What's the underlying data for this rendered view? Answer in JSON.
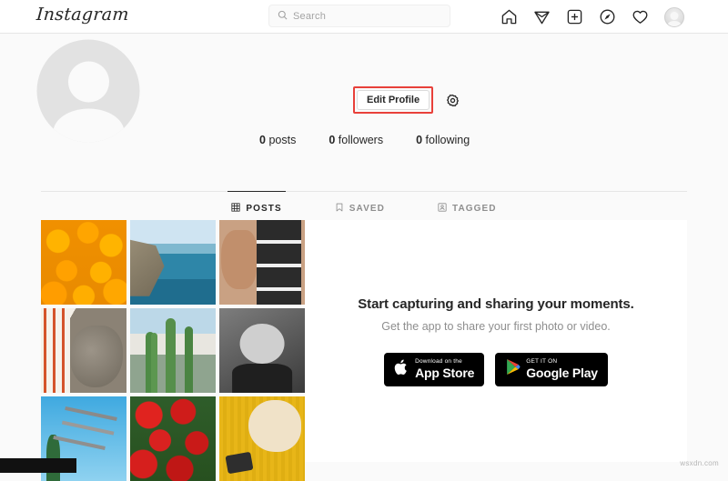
{
  "nav": {
    "logo": "Instagram",
    "search": {
      "placeholder": "Search",
      "value": ""
    },
    "icons": [
      {
        "name": "home-icon",
        "label": "Home"
      },
      {
        "name": "direct-send-icon",
        "label": "Direct"
      },
      {
        "name": "new-post-icon",
        "label": "New Post"
      },
      {
        "name": "explore-compass-icon",
        "label": "Explore"
      },
      {
        "name": "activity-heart-icon",
        "label": "Activity"
      },
      {
        "name": "profile-avatar-icon",
        "label": "Profile"
      }
    ]
  },
  "profile": {
    "avatar_alt": "default-profile-picture",
    "edit_profile_label": "Edit Profile",
    "settings_icon_label": "Options",
    "highlight_color": "#e8403a",
    "stats": [
      {
        "count": "0",
        "label": "posts"
      },
      {
        "count": "0",
        "label": "followers"
      },
      {
        "count": "0",
        "label": "following"
      }
    ]
  },
  "tabs": [
    {
      "label": "POSTS",
      "icon": "grid-icon",
      "active": true
    },
    {
      "label": "SAVED",
      "icon": "bookmark-icon",
      "active": false
    },
    {
      "label": "TAGGED",
      "icon": "tagged-person-icon",
      "active": false
    }
  ],
  "grid": {
    "cells": [
      {
        "name": "photo-oranges",
        "class": "ph-oranges"
      },
      {
        "name": "photo-coastline",
        "class": "ph-coast"
      },
      {
        "name": "photo-photobooth-strip",
        "class": "ph-strip"
      },
      {
        "name": "photo-dog",
        "class": "ph-dog"
      },
      {
        "name": "photo-cactus",
        "class": "ph-cactus"
      },
      {
        "name": "photo-baby-bw",
        "class": "ph-baby"
      },
      {
        "name": "photo-sky-ride",
        "class": "ph-ride"
      },
      {
        "name": "photo-red-flowers",
        "class": "ph-flowers"
      },
      {
        "name": "photo-cat-yellow-blanket",
        "class": "ph-cat"
      }
    ]
  },
  "promo": {
    "headline": "Start capturing and sharing your moments.",
    "subtext": "Get the app to share your first photo or video.",
    "app_store": {
      "small": "Download on the",
      "big": "App Store"
    },
    "google_play": {
      "small": "GET IT ON",
      "big": "Google Play"
    }
  },
  "watermark": "wsxdn.com"
}
